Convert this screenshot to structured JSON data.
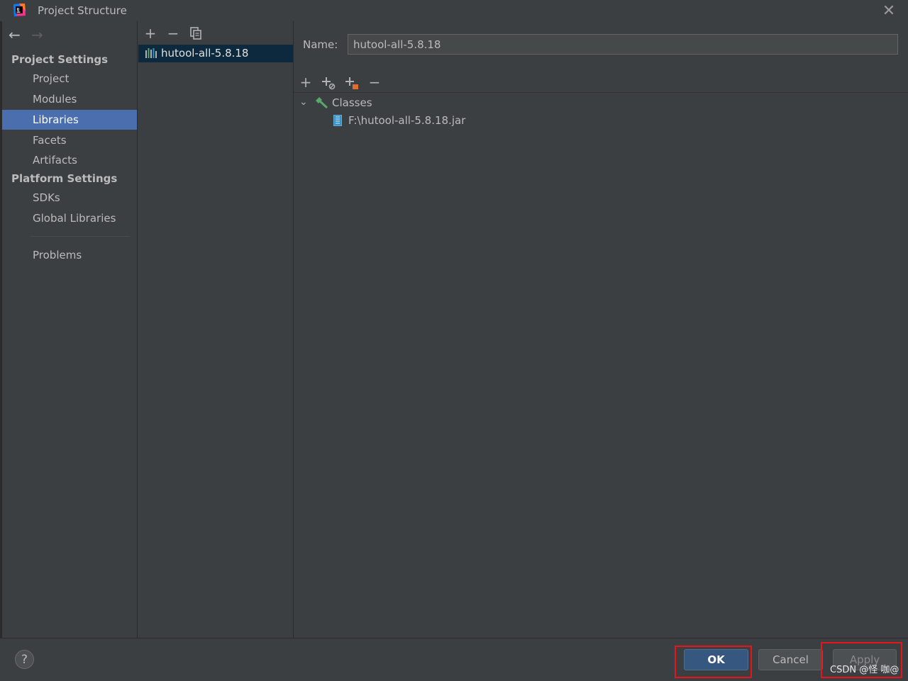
{
  "window": {
    "title": "Project Structure",
    "close_glyph": "✕"
  },
  "nav": {
    "back_glyph": "←",
    "forward_glyph": "→"
  },
  "sidebar": {
    "groups": [
      {
        "title": "Project Settings",
        "items": [
          "Project",
          "Modules",
          "Libraries",
          "Facets",
          "Artifacts"
        ]
      },
      {
        "title": "Platform Settings",
        "items": [
          "SDKs",
          "Global Libraries"
        ]
      }
    ],
    "problems": "Problems",
    "selected": "Libraries"
  },
  "middle": {
    "toolbar": {
      "add": "+",
      "remove": "−"
    },
    "library": "hutool-all-5.8.18"
  },
  "detail": {
    "name_label": "Name:",
    "name_value": "hutool-all-5.8.18",
    "toolbar": {
      "add": "+",
      "remove": "−"
    },
    "tree": {
      "chevron": "⌄",
      "root": "Classes",
      "children": [
        "F:\\hutool-all-5.8.18.jar"
      ]
    }
  },
  "footer": {
    "help": "?",
    "ok": "OK",
    "cancel": "Cancel",
    "apply": "Apply",
    "watermark": "CSDN @怪 咖@"
  },
  "colors": {
    "selection": "#4b6eaf",
    "ok_button": "#365880",
    "highlight": "#e8141a",
    "classes_icon": "#59a869"
  }
}
